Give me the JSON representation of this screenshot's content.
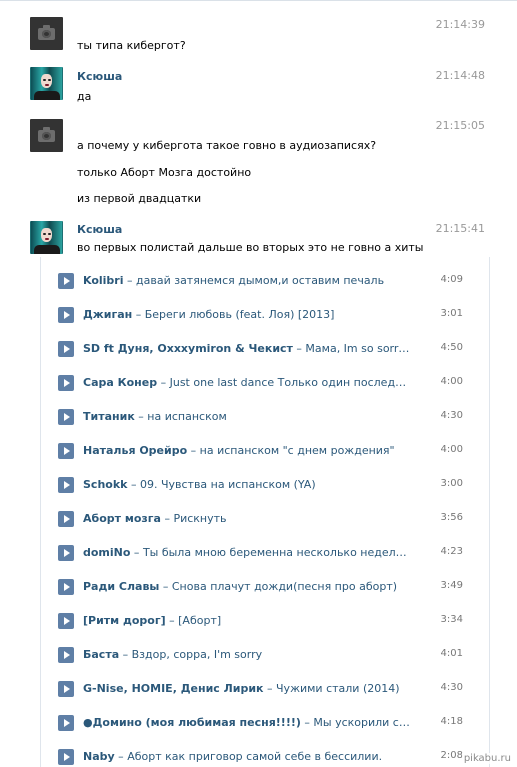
{
  "messages": [
    {
      "author": "",
      "time": "21:14:39",
      "avatar": "camera-icon",
      "lines": [
        "ты типа кибергот?"
      ]
    },
    {
      "author": "Ксюша",
      "time": "21:14:48",
      "avatar": "user-photo",
      "lines": [
        "да"
      ]
    },
    {
      "author": "",
      "time": "21:15:05",
      "avatar": "camera-icon",
      "lines": [
        "а почему у кибергота такое говно в аудиозаписях?",
        "только Аборт Мозга достойно",
        "из первой двадцатки"
      ]
    },
    {
      "author": "Ксюша",
      "time": "21:15:41",
      "avatar": "user-photo",
      "lines": [
        "во первых полистай дальше во вторых это не говно а хиты"
      ]
    }
  ],
  "audio": [
    {
      "artist": "Kolibri",
      "title": "давай затянемся дымом,и оставим печаль",
      "duration": "4:09"
    },
    {
      "artist": "Джиган",
      "title": "Береги любовь (feat. Лоя) [2013]",
      "duration": "3:01"
    },
    {
      "artist": "SD ft Дуня, Oxxxymiron & Чекист",
      "title": "Мама, Im so sorry ft Ду...",
      "duration": "4:50"
    },
    {
      "artist": "Сара Конер",
      "title": "Just one last dance Только один последний тан...",
      "duration": "4:00"
    },
    {
      "artist": "Титаник",
      "title": "на испанском",
      "duration": "4:30"
    },
    {
      "artist": "Наталья Орейро",
      "title": "на испанском \"с днем рождения\"",
      "duration": "4:00"
    },
    {
      "artist": "Schokk",
      "title": "09. Чувства на испанском (YA)",
      "duration": "3:00"
    },
    {
      "artist": "Аборт мозга",
      "title": "Рискнуть",
      "duration": "3:56"
    },
    {
      "artist": "domiNo",
      "title": "Ты была мною беременна несколько недель Но ты ...",
      "duration": "4:23"
    },
    {
      "artist": "Ради Славы",
      "title": "Снова плачут дожди(песня про аборт)",
      "duration": "3:49"
    },
    {
      "artist": "[Ритм дорог]",
      "title": "[Аборт]",
      "duration": "3:34"
    },
    {
      "artist": "Баста",
      "title": "Вздор, соррa, I'm sorry",
      "duration": "4:01"
    },
    {
      "artist": "G-Nise, HOMIE, Денис Лирик",
      "title": "Чужими стали (2014)",
      "duration": "4:30"
    },
    {
      "artist": "●Домино (моя любимая песня!!!!)",
      "title": "Мы ускорили свой бит,...",
      "duration": "4:18"
    },
    {
      "artist": "Naby",
      "title": "Аборт как приговор самой себе в бессилии.",
      "duration": "2:08"
    }
  ],
  "watermark": "pikabu.ru",
  "colors": {
    "link": "#2b587a",
    "play": "#5f7fa6",
    "time": "#999999"
  }
}
